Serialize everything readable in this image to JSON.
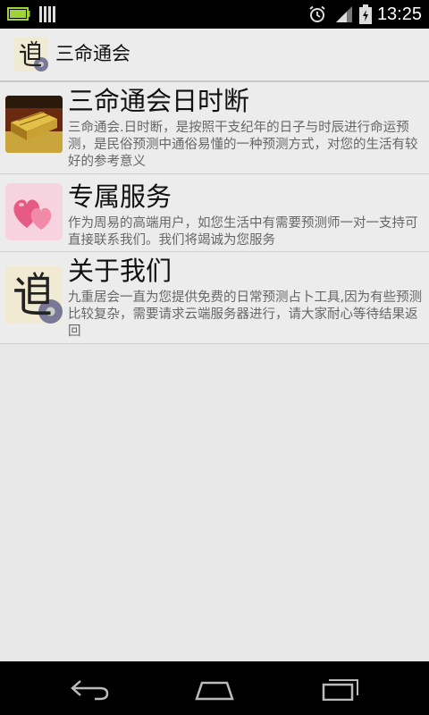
{
  "status_bar": {
    "time": "13:25",
    "icons": [
      "battery-full-icon",
      "signal-icon",
      "alarm-icon",
      "cell-signal-icon",
      "battery-charging-icon"
    ]
  },
  "action_bar": {
    "title": "三命通会",
    "icon": "dao-logo-icon"
  },
  "list": {
    "items": [
      {
        "title": "三命通会日时断",
        "description": "三命通会.日时断，是按照干支纪年的日子与时辰进行命运预测，是民俗预测中通俗易懂的一种预测方式，对您的生活有较好的参考意义",
        "icon": "gold-bars-icon"
      },
      {
        "title": "专属服务",
        "description": "作为周易的高端用户，如您生活中有需要预测师一对一支持可直接联系我们。我们将竭诚为您服务",
        "icon": "pink-hearts-icon"
      },
      {
        "title": "关于我们",
        "description": "九重居会一直为您提供免费的日常预测占卜工具,因为有些预测比较复杂，需要请求云端服务器进行，请大家耐心等待结果返回",
        "icon": "dao-logo-icon"
      }
    ]
  },
  "nav_bar": {
    "icons": [
      "back-icon",
      "home-icon",
      "recent-apps-icon"
    ]
  }
}
